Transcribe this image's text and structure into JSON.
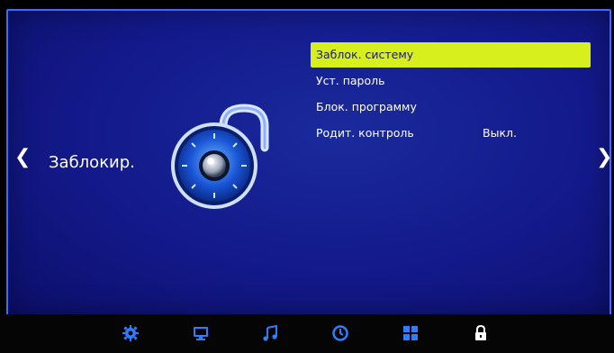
{
  "page": {
    "section_title": "Заблокир.",
    "nav_left_glyph": "❮",
    "nav_right_glyph": "❯"
  },
  "menu": {
    "items": [
      {
        "label": "Заблок. систему",
        "value": "",
        "selected": true
      },
      {
        "label": "Уст. пароль",
        "value": "",
        "selected": false
      },
      {
        "label": "Блок. программу",
        "value": "",
        "selected": false
      },
      {
        "label": "Родит. контроль",
        "value": "Выкл.",
        "selected": false
      }
    ]
  },
  "bottom_bar": {
    "icons": [
      "gear-icon",
      "monitor-icon",
      "music-note-icon",
      "clock-icon",
      "grid-icon",
      "lock-icon"
    ],
    "accent_color": "#2f7dff"
  },
  "colors": {
    "selection": "#d8ef1e",
    "background": "#13198a"
  }
}
